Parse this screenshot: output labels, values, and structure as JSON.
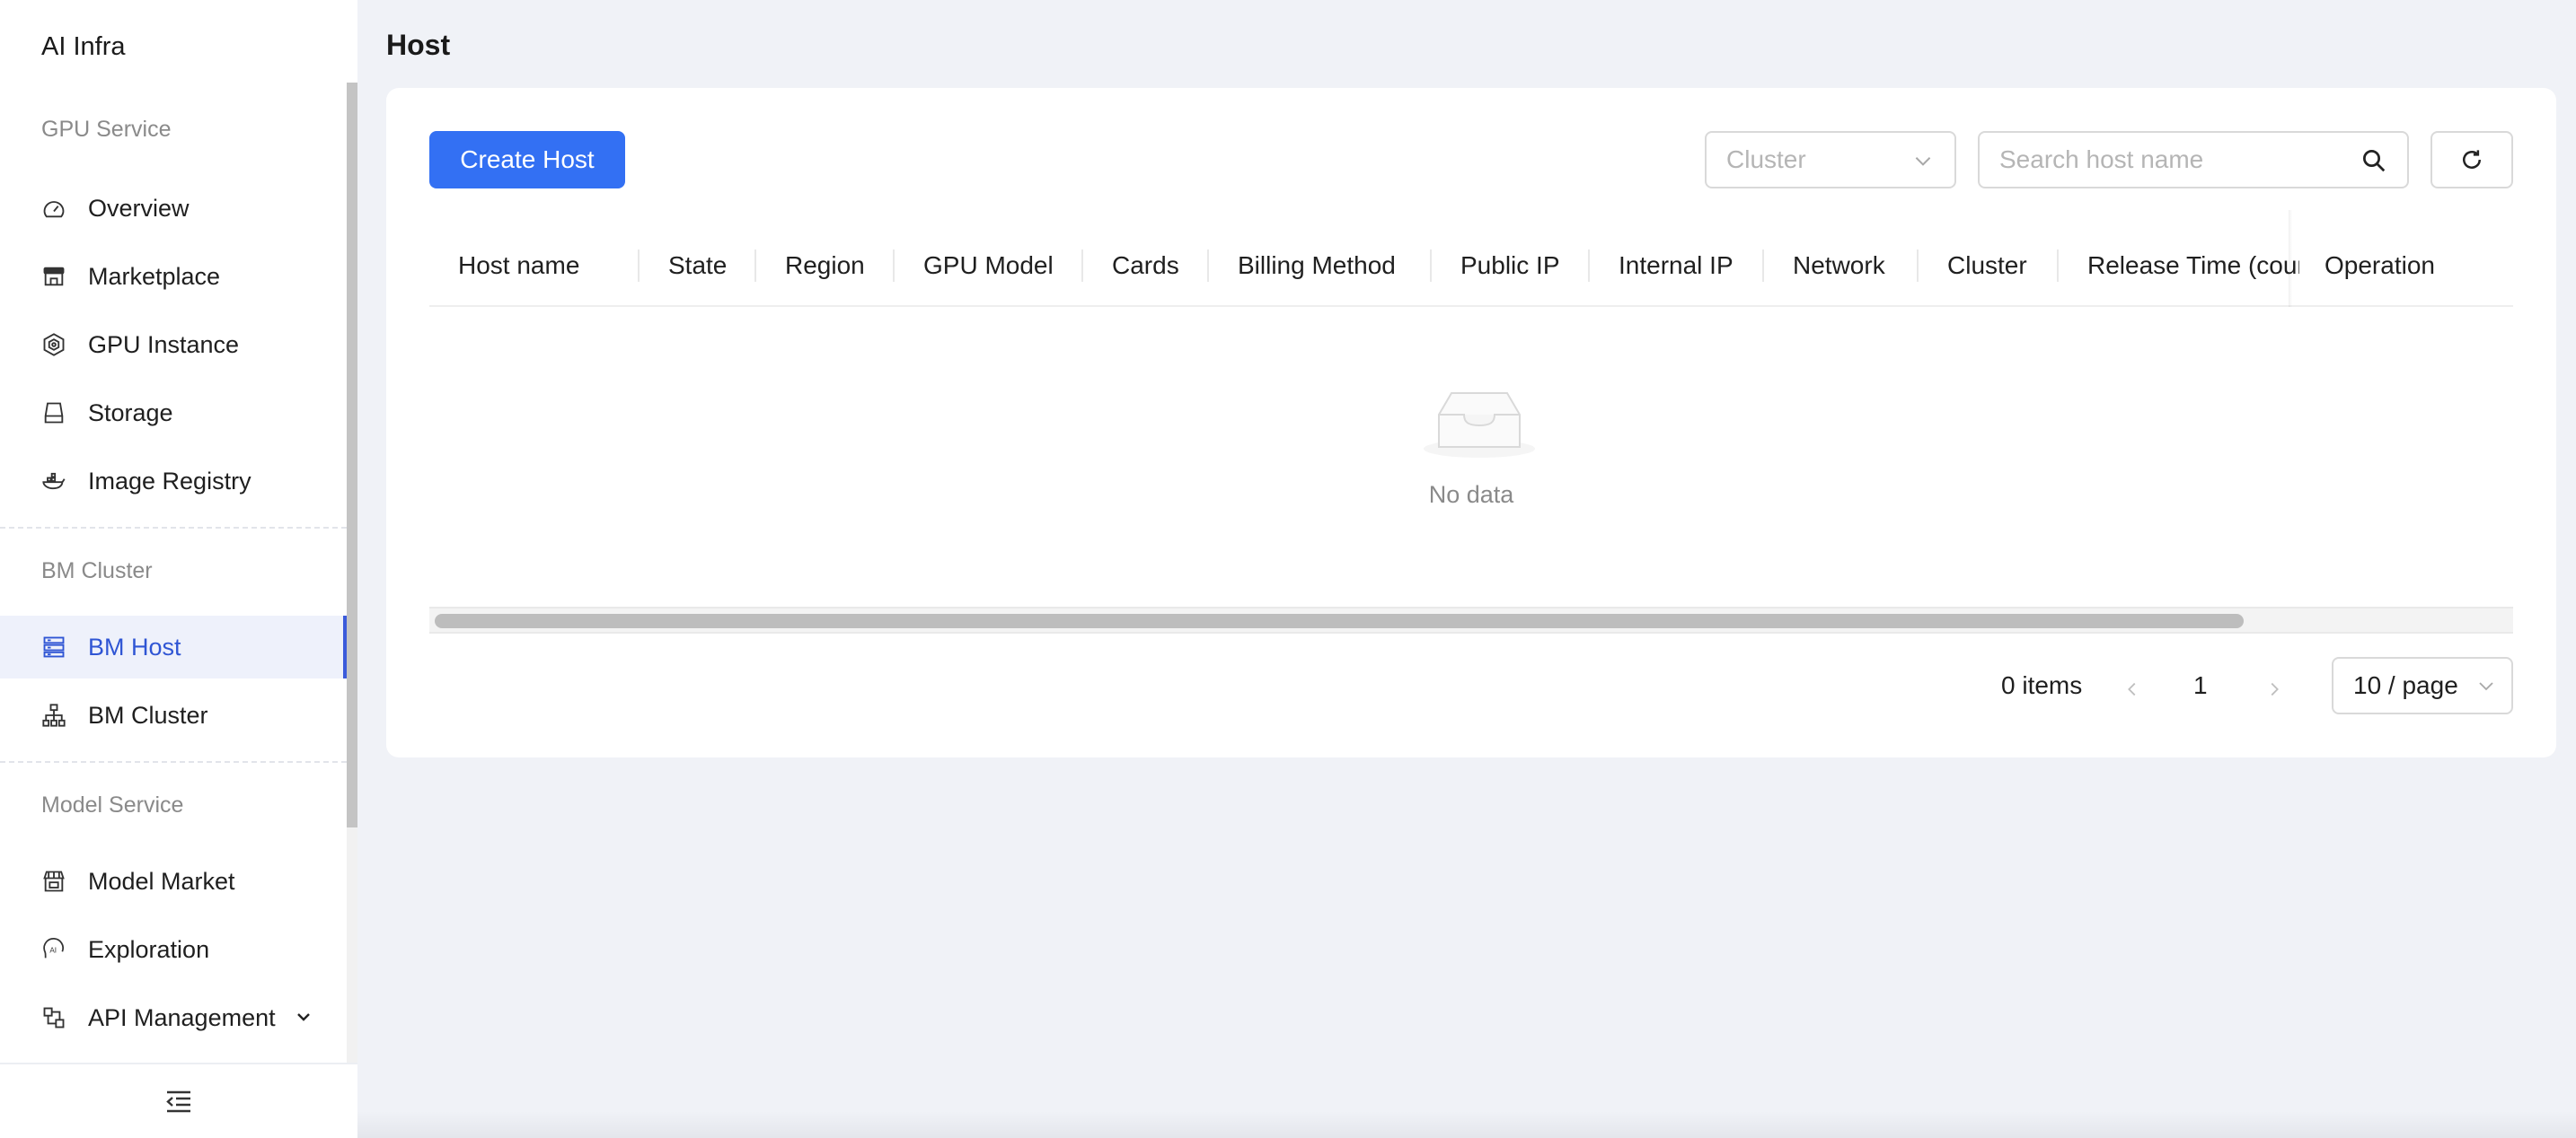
{
  "app": {
    "brand": "AI Infra"
  },
  "sidebar": {
    "groups": [
      {
        "title": "GPU Service",
        "items": [
          {
            "label": "Overview",
            "icon": "dashboard-icon"
          },
          {
            "label": "Marketplace",
            "icon": "store-icon"
          },
          {
            "label": "GPU Instance",
            "icon": "chip-icon"
          },
          {
            "label": "Storage",
            "icon": "disk-icon"
          },
          {
            "label": "Image Registry",
            "icon": "container-icon"
          }
        ]
      },
      {
        "title": "BM Cluster",
        "items": [
          {
            "label": "BM Host",
            "icon": "server-icon",
            "active": true
          },
          {
            "label": "BM Cluster",
            "icon": "cluster-icon"
          }
        ]
      },
      {
        "title": "Model Service",
        "items": [
          {
            "label": "Model Market",
            "icon": "market-icon"
          },
          {
            "label": "Exploration",
            "icon": "ai-icon"
          },
          {
            "label": "API Management",
            "icon": "api-icon",
            "expandable": true
          }
        ]
      }
    ],
    "accent_color": "#3b5bdb"
  },
  "main": {
    "title": "Host",
    "toolbar": {
      "create_label": "Create Host",
      "cluster_placeholder": "Cluster",
      "search_placeholder": "Search host name"
    },
    "table": {
      "columns": [
        "Host name",
        "State",
        "Region",
        "GPU Model",
        "Cards",
        "Billing Method",
        "Public IP",
        "Internal IP",
        "Network",
        "Cluster",
        "Release Time (countdown)",
        "Operation"
      ],
      "empty_text": "No data"
    },
    "pagination": {
      "total": "0 items",
      "current_page": "1",
      "page_size": "10 / page"
    },
    "primary_color": "#3370f3"
  }
}
